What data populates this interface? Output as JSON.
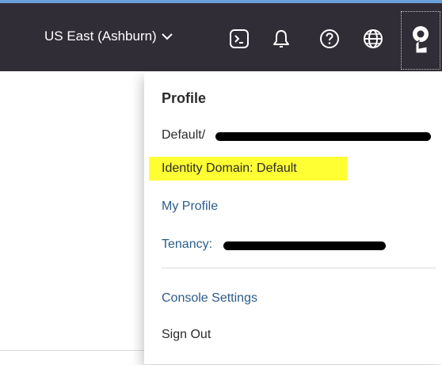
{
  "topbar": {
    "region_label": "US East (Ashburn)",
    "icons": [
      "terminal-icon",
      "bell-icon",
      "help-icon",
      "globe-icon",
      "user-icon"
    ],
    "colors": {
      "background": "#312d36",
      "accent": "#6a9fd8"
    }
  },
  "profile_menu": {
    "heading": "Profile",
    "default_domain_text": "Default/",
    "identity_domain": "Identity Domain: Default",
    "my_profile": "My Profile",
    "tenancy_label": "Tenancy:",
    "console_settings": "Console Settings",
    "sign_out": "Sign Out",
    "highlight_color": "#ffff33",
    "link_color": "#2c5c8a"
  }
}
